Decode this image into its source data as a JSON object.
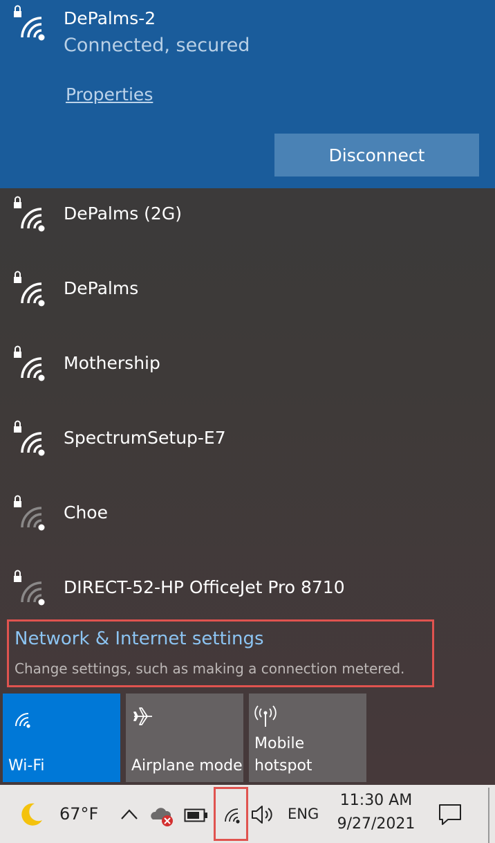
{
  "connected_network": {
    "name": "DePalms-2",
    "status": "Connected, secured",
    "properties_label": "Properties",
    "disconnect_label": "Disconnect"
  },
  "networks": [
    {
      "name": "DePalms (2G)",
      "signal": "strong"
    },
    {
      "name": "DePalms",
      "signal": "strong"
    },
    {
      "name": "Mothership",
      "signal": "strong"
    },
    {
      "name": "SpectrumSetup-E7",
      "signal": "strong"
    },
    {
      "name": "Choe",
      "signal": "weak"
    },
    {
      "name": "DIRECT-52-HP OfficeJet Pro 8710",
      "signal": "weak"
    }
  ],
  "settings": {
    "title": "Network & Internet settings",
    "subtitle": "Change settings, such as making a connection metered."
  },
  "tiles": [
    {
      "label": "Wi-Fi",
      "icon": "wifi-icon",
      "active": true
    },
    {
      "label": "Airplane mode",
      "icon": "airplane-icon",
      "active": false
    },
    {
      "label_line1": "Mobile",
      "label_line2": "hotspot",
      "icon": "hotspot-icon",
      "active": false
    }
  ],
  "taskbar": {
    "temperature": "67°F",
    "language": "ENG",
    "time": "11:30 AM",
    "date": "9/27/2021"
  },
  "colors": {
    "accent": "#0078d7",
    "connected_bg": "#1a5c9b",
    "highlight": "#e0534f",
    "link": "#8cc4f2"
  }
}
